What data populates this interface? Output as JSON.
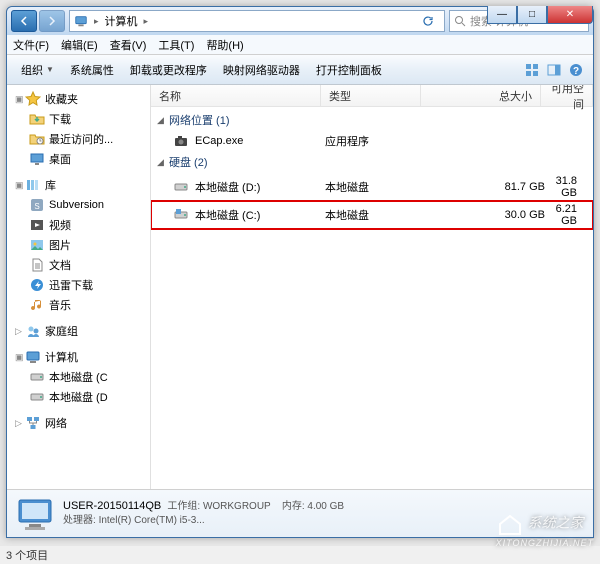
{
  "titlebar": {
    "breadcrumb": [
      "计算机"
    ],
    "search_placeholder": "搜索 计算机"
  },
  "win_buttons": {
    "min": "—",
    "max": "□",
    "close": "✕"
  },
  "menubar": [
    "文件(F)",
    "编辑(E)",
    "查看(V)",
    "工具(T)",
    "帮助(H)"
  ],
  "toolbar": {
    "items": [
      "组织",
      "系统属性",
      "卸载或更改程序",
      "映射网络驱动器",
      "打开控制面板"
    ]
  },
  "columns": {
    "name": "名称",
    "type": "类型",
    "size": "总大小",
    "free": "可用空间"
  },
  "sidebar": {
    "groups": [
      {
        "label": "收藏夹",
        "icon": "star",
        "items": [
          {
            "label": "下载",
            "icon": "folder-dl"
          },
          {
            "label": "最近访问的...",
            "icon": "folder-recent"
          },
          {
            "label": "桌面",
            "icon": "desktop"
          }
        ]
      },
      {
        "label": "库",
        "icon": "library",
        "items": [
          {
            "label": "Subversion",
            "icon": "svn"
          },
          {
            "label": "视频",
            "icon": "video"
          },
          {
            "label": "图片",
            "icon": "pictures"
          },
          {
            "label": "文档",
            "icon": "docs"
          },
          {
            "label": "迅雷下载",
            "icon": "xunlei"
          },
          {
            "label": "音乐",
            "icon": "music"
          }
        ]
      },
      {
        "label": "家庭组",
        "icon": "homegroup",
        "items": []
      },
      {
        "label": "计算机",
        "icon": "computer",
        "selected": true,
        "items": [
          {
            "label": "本地磁盘 (C",
            "icon": "drive"
          },
          {
            "label": "本地磁盘 (D",
            "icon": "drive"
          }
        ]
      },
      {
        "label": "网络",
        "icon": "network",
        "items": []
      }
    ]
  },
  "content": {
    "groups": [
      {
        "label": "网络位置 (1)",
        "items": [
          {
            "name": "ECap.exe",
            "type": "应用程序",
            "size": "",
            "free": "",
            "icon": "camera"
          }
        ]
      },
      {
        "label": "硬盘 (2)",
        "items": [
          {
            "name": "本地磁盘 (D:)",
            "type": "本地磁盘",
            "size": "81.7 GB",
            "free": "31.8 GB",
            "icon": "drive"
          },
          {
            "name": "本地磁盘 (C:)",
            "type": "本地磁盘",
            "size": "30.0 GB",
            "free": "6.21 GB",
            "icon": "drive-win",
            "highlight": true
          }
        ]
      }
    ]
  },
  "details": {
    "name": "USER-20150114QB",
    "workgroup_label": "工作组:",
    "workgroup": "WORKGROUP",
    "memory_label": "内存:",
    "memory": "4.00 GB",
    "cpu_label": "处理器:",
    "cpu": "Intel(R) Core(TM) i5-3..."
  },
  "status": "3 个项目",
  "watermark": "系统之家"
}
